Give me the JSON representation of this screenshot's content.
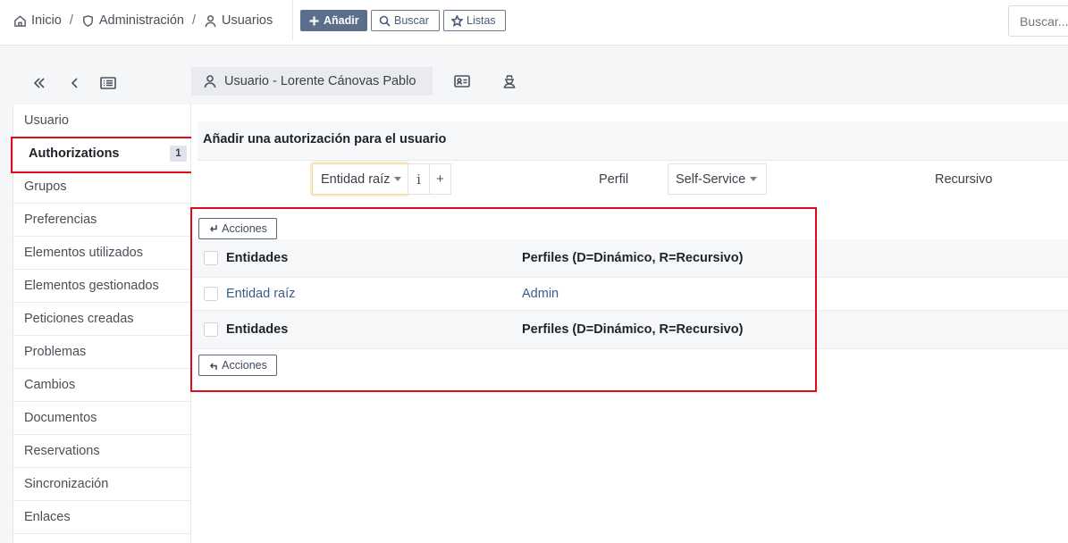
{
  "breadcrumb": [
    {
      "label": "Inicio",
      "icon": "home-icon"
    },
    {
      "label": "Administración",
      "icon": "shield-icon"
    },
    {
      "label": "Usuarios",
      "icon": "user-icon"
    }
  ],
  "toolbar": {
    "add_label": "Añadir",
    "search_label": "Buscar",
    "lists_label": "Listas"
  },
  "search": {
    "placeholder": "Buscar..."
  },
  "tab": {
    "title": "Usuario - Lorente Cánovas Pablo"
  },
  "sidebar": {
    "items": [
      {
        "label": "Usuario"
      },
      {
        "label": "Authorizations",
        "badge": "1",
        "active": true
      },
      {
        "label": "Grupos"
      },
      {
        "label": "Preferencias"
      },
      {
        "label": "Elementos utilizados"
      },
      {
        "label": "Elementos gestionados"
      },
      {
        "label": "Peticiones creadas"
      },
      {
        "label": "Problemas"
      },
      {
        "label": "Cambios"
      },
      {
        "label": "Documentos"
      },
      {
        "label": "Reservations"
      },
      {
        "label": "Sincronización"
      },
      {
        "label": "Enlaces"
      }
    ]
  },
  "form": {
    "title": "Añadir una autorización para el usuario",
    "entity_value": "Entidad raíz",
    "info_label": "i",
    "add_label": "+",
    "profile_label": "Perfil",
    "profile_value": "Self-Service",
    "recursive_label": "Recursivo"
  },
  "table": {
    "actions_label": "Acciones",
    "headers": [
      "Entidades",
      "Perfiles (D=Dinámico, R=Recursivo)"
    ],
    "rows": [
      {
        "entity": "Entidad raíz",
        "profile": "Admin"
      }
    ]
  },
  "colors": {
    "accent": "#5b6e8c",
    "highlight": "#e00a1c",
    "link": "#3d5a8c"
  }
}
